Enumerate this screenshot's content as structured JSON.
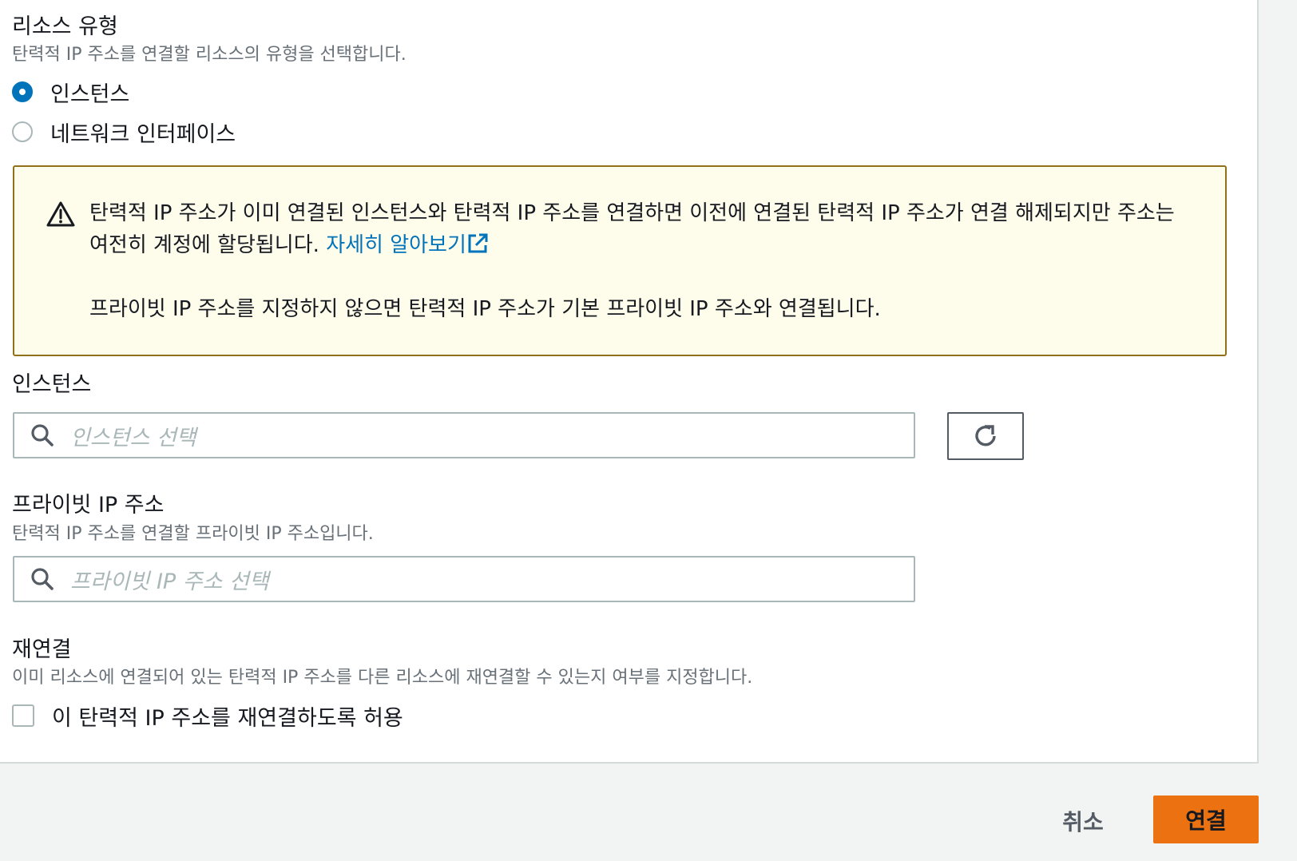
{
  "resource_type": {
    "label": "리소스 유형",
    "description": "탄력적 IP 주소를 연결할 리소스의 유형을 선택합니다.",
    "options": [
      {
        "label": "인스턴스",
        "selected": true
      },
      {
        "label": "네트워크 인터페이스",
        "selected": false
      }
    ]
  },
  "alert": {
    "type": "warning",
    "icon": "warning-icon",
    "paragraph1": "탄력적 IP 주소가 이미 연결된 인스턴스와 탄력적 IP 주소를 연결하면 이전에 연결된 탄력적 IP 주소가 연결 해제되지만 주소는 여전히 계정에 할당됩니다.",
    "link_label": "자세히 알아보기",
    "link_icon": "external-link-icon",
    "paragraph2": "프라이빗 IP 주소를 지정하지 않으면 탄력적 IP 주소가 기본 프라이빗 IP 주소와 연결됩니다."
  },
  "instance": {
    "label": "인스턴스",
    "placeholder": "인스턴스 선택",
    "refresh_icon": "refresh-icon"
  },
  "private_ip": {
    "label": "프라이빗 IP 주소",
    "description": "탄력적 IP 주소를 연결할 프라이빗 IP 주소입니다.",
    "placeholder": "프라이빗 IP 주소 선택"
  },
  "reassociation": {
    "label": "재연결",
    "description": "이미 리소스에 연결되어 있는 탄력적 IP 주소를 다른 리소스에 재연결할 수 있는지 여부를 지정합니다.",
    "checkbox_label": "이 탄력적 IP 주소를 재연결하도록 허용",
    "checked": false
  },
  "footer": {
    "cancel_label": "취소",
    "submit_label": "연결"
  },
  "colors": {
    "primary": "#ec7211",
    "link": "#0073bb",
    "warning_border": "#907018",
    "warning_bg": "#fefcea"
  }
}
